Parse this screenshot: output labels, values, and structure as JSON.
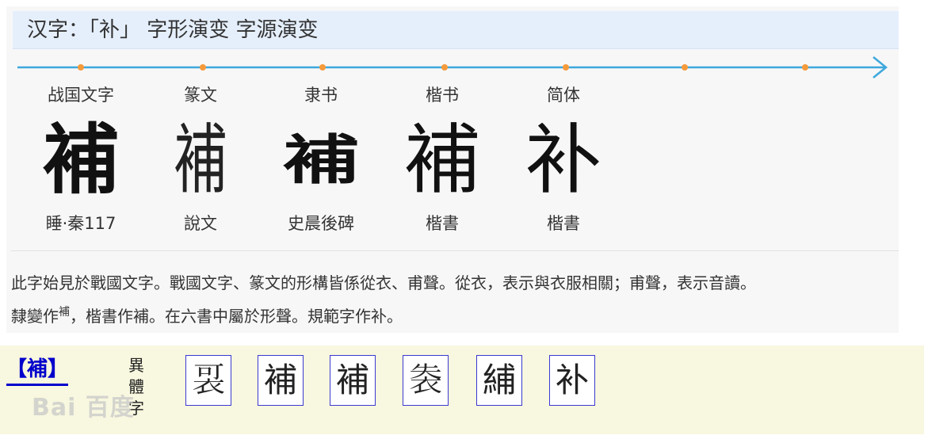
{
  "title": "汉字：「补」 字形演变 字源演变",
  "timeline": {
    "line_color": "#3ea8dc",
    "dot_color": "#f59a3b"
  },
  "eras": [
    {
      "label": "战国文字",
      "glyph": "補",
      "source": "睡·秦117"
    },
    {
      "label": "篆文",
      "glyph": "補",
      "source": "說文"
    },
    {
      "label": "隶书",
      "glyph": "補",
      "source": "史晨後碑"
    },
    {
      "label": "楷书",
      "glyph": "補",
      "source": "楷書"
    },
    {
      "label": "简体",
      "glyph": "补",
      "source": "楷書"
    }
  ],
  "description": {
    "line1": "此字始見於戰國文字。戰國文字、篆文的形構皆係從衣、甫聲。從衣，表示與衣服相關；甫聲，表示音讀。",
    "line2_prefix": "隸變作",
    "line2_glyph": "補",
    "line2_suffix": "，楷書作補。在六書中屬於形聲。規範字作补。"
  },
  "variants": {
    "link_label": "【補】",
    "caption_chars": [
      "異",
      "體",
      "字"
    ],
    "boxes": [
      "𧙑",
      "補",
      "補",
      "𧙍",
      "䋠",
      "补"
    ]
  },
  "watermark": "Bai 百度"
}
